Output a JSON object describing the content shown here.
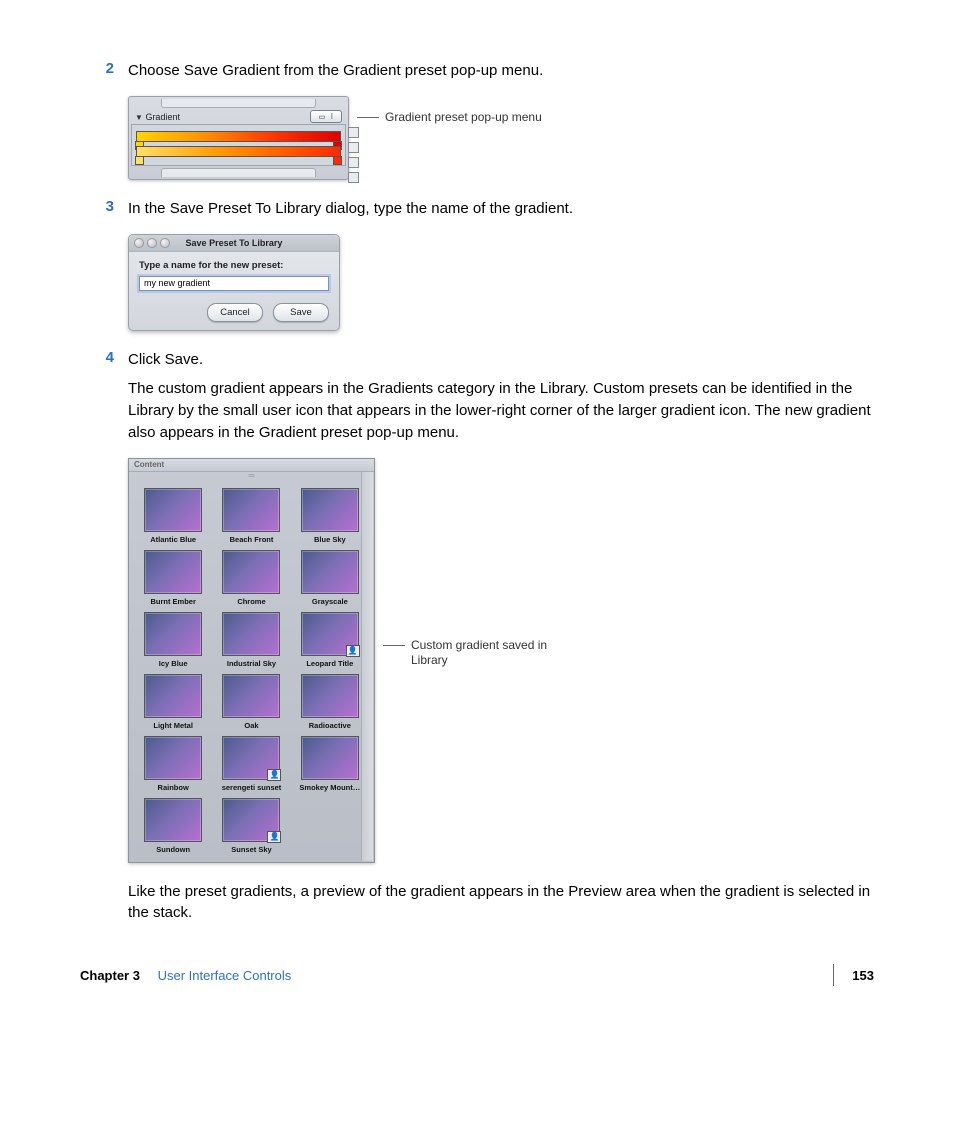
{
  "steps": {
    "s2": {
      "num": "2",
      "text": "Choose Save Gradient from the Gradient preset pop-up menu."
    },
    "s3": {
      "num": "3",
      "text": "In the Save Preset To Library dialog, type the name of the gradient."
    },
    "s4": {
      "num": "4",
      "text": "Click Save."
    }
  },
  "para1": "The custom gradient appears in the Gradients category in the Library. Custom presets can be identified in the Library by the small user icon that appears in the lower-right corner of the larger gradient icon. The new gradient also appears in the Gradient preset pop-up menu.",
  "para2": "Like the preset gradients, a preview of the gradient appears in the Preview area when the gradient is selected in the stack.",
  "fig1": {
    "panel_title": "Gradient",
    "callout": "Gradient preset pop-up menu"
  },
  "fig2": {
    "title": "Save Preset To Library",
    "prompt": "Type a name for the new preset:",
    "input_value": "my new gradient",
    "cancel": "Cancel",
    "save": "Save"
  },
  "fig3": {
    "header": "Content",
    "callout": "Custom gradient saved in Library",
    "items": [
      {
        "label": "Atlantic Blue",
        "user": false
      },
      {
        "label": "Beach Front",
        "user": false
      },
      {
        "label": "Blue Sky",
        "user": false
      },
      {
        "label": "Burnt Ember",
        "user": false
      },
      {
        "label": "Chrome",
        "user": false
      },
      {
        "label": "Grayscale",
        "user": false
      },
      {
        "label": "Icy Blue",
        "user": false
      },
      {
        "label": "Industrial Sky",
        "user": false
      },
      {
        "label": "Leopard Title",
        "user": true
      },
      {
        "label": "Light Metal",
        "user": false
      },
      {
        "label": "Oak",
        "user": false
      },
      {
        "label": "Radioactive",
        "user": false
      },
      {
        "label": "Rainbow",
        "user": false
      },
      {
        "label": "serengeti sunset",
        "user": true
      },
      {
        "label": "Smokey Mount…",
        "user": false
      },
      {
        "label": "Sundown",
        "user": false
      },
      {
        "label": "Sunset Sky",
        "user": true
      }
    ]
  },
  "footer": {
    "chapter": "Chapter 3",
    "title": "User Interface Controls",
    "page": "153"
  }
}
